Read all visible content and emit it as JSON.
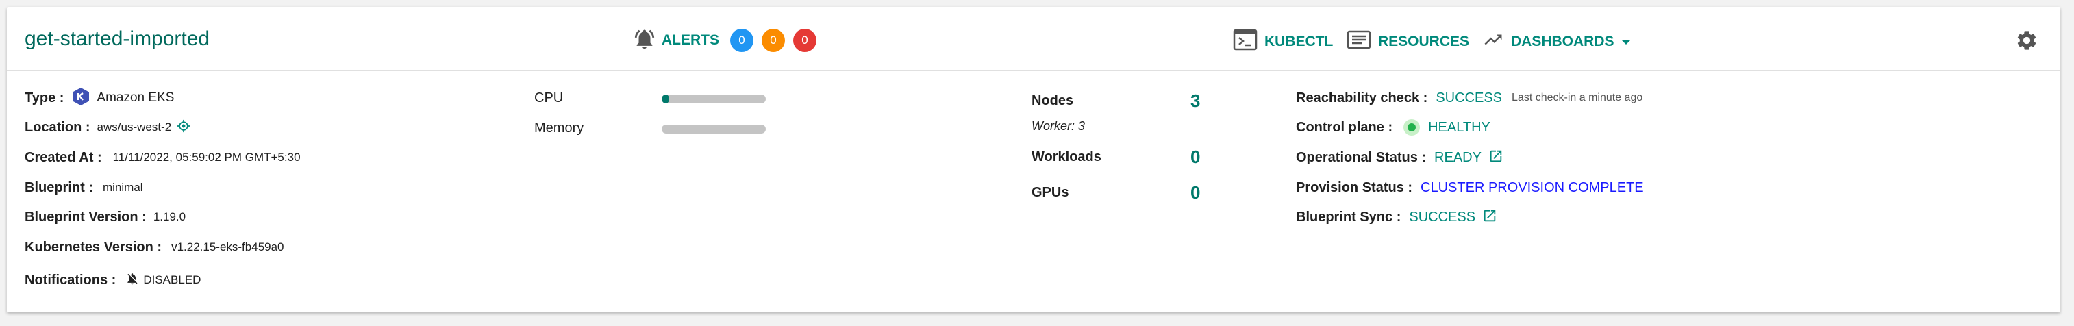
{
  "header": {
    "cluster_name": "get-started-imported",
    "alerts_label": "ALERTS",
    "alert_counts": [
      "0",
      "0",
      "0"
    ],
    "alert_colors": [
      "#2196f3",
      "#fb8c00",
      "#e53935"
    ],
    "kubectl_label": "KUBECTL",
    "resources_label": "RESOURCES",
    "dashboards_label": "DASHBOARDS"
  },
  "details": {
    "type_label": "Type :",
    "type_value": "Amazon EKS",
    "location_label": "Location :",
    "location_value": "aws/us-west-2",
    "created_label": "Created At :",
    "created_value": "11/11/2022, 05:59:02 PM GMT+5:30",
    "blueprint_label": "Blueprint :",
    "blueprint_value": "minimal",
    "blueprint_version_label": "Blueprint Version :",
    "blueprint_version_value": "1.19.0",
    "k8s_version_label": "Kubernetes Version :",
    "k8s_version_value": "v1.22.15-eks-fb459a0",
    "notifications_label": "Notifications :",
    "notifications_value": "DISABLED"
  },
  "usage": {
    "cpu_label": "CPU",
    "cpu_fraction": 0.07,
    "memory_label": "Memory",
    "memory_fraction": 0.0
  },
  "metrics": {
    "nodes_label": "Nodes",
    "nodes_value": "3",
    "worker_text": "Worker: 3",
    "workloads_label": "Workloads",
    "workloads_value": "0",
    "gpus_label": "GPUs",
    "gpus_value": "0"
  },
  "status": {
    "reachability_label": "Reachability check :",
    "reachability_value": "SUCCESS",
    "last_checkin": "Last check-in  a minute ago",
    "control_plane_label": "Control plane :",
    "control_plane_value": "HEALTHY",
    "operational_label": "Operational Status :",
    "operational_value": "READY",
    "provision_label": "Provision Status :",
    "provision_value": "CLUSTER PROVISION COMPLETE",
    "blueprint_sync_label": "Blueprint Sync :",
    "blueprint_sync_value": "SUCCESS"
  }
}
